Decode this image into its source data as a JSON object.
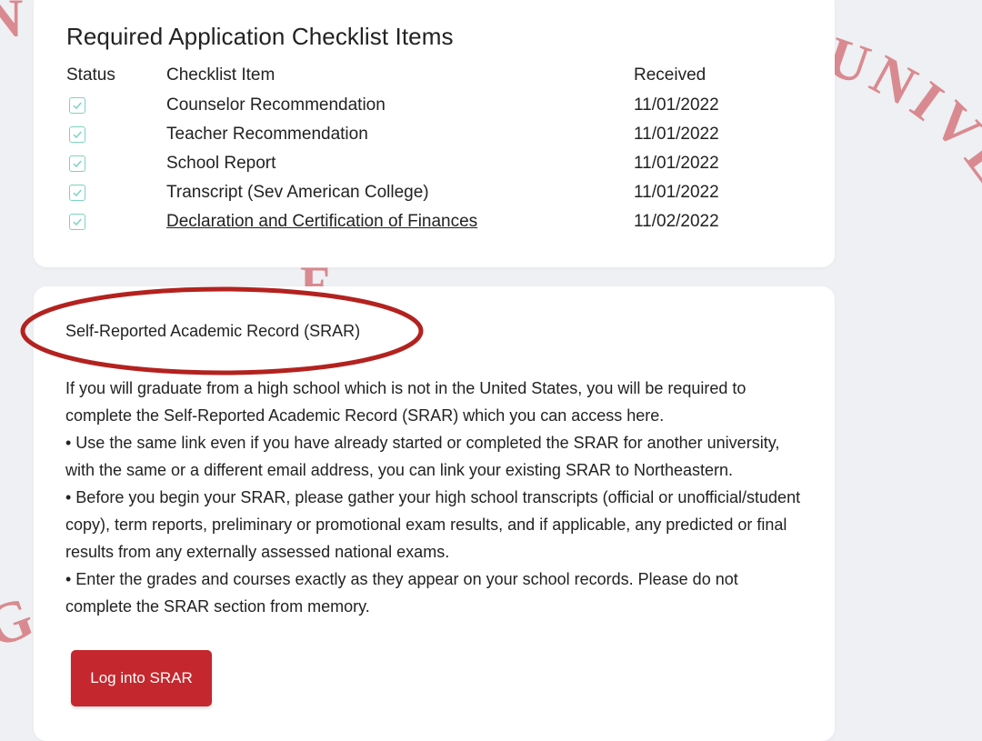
{
  "watermark": {
    "arc_right_text": "UNIVERSITY",
    "left_top_glyph": "N",
    "left_bottom_glyph": "G",
    "middle_glyph": "F",
    "color": "#d98a90"
  },
  "checklist": {
    "title": "Required Application Checklist Items",
    "headers": {
      "status": "Status",
      "item": "Checklist Item",
      "received": "Received"
    },
    "rows": [
      {
        "item": "Counselor Recommendation",
        "received": "11/01/2022",
        "is_link": false
      },
      {
        "item": "Teacher Recommendation",
        "received": "11/01/2022",
        "is_link": false
      },
      {
        "item": "School Report",
        "received": "11/01/2022",
        "is_link": false
      },
      {
        "item": "Transcript (Sev American College)",
        "received": "11/01/2022",
        "is_link": false
      },
      {
        "item": "Declaration and Certification of Finances",
        "received": "11/02/2022",
        "is_link": true
      }
    ],
    "check_color": "#7fd2bf"
  },
  "srar": {
    "heading": "Self-Reported Academic Record (SRAR)",
    "highlight_color": "#b3221f",
    "paragraphs": [
      "If you will graduate from a high school which is not in the United States, you will be required to complete the Self-Reported Academic Record (SRAR) which you can access here.",
      "• Use the same link even if you have already started or completed the SRAR for another university, with the same or a different email address, you can link your existing SRAR to Northeastern.",
      "• Before you begin your SRAR, please gather your high school transcripts (official or unofficial/student copy), term reports, preliminary or promotional exam results, and if applicable, any predicted or final results from any externally assessed national exams.",
      "• Enter the grades and courses exactly as they appear on your school records. Please do not complete the SRAR section from memory."
    ],
    "button_label": "Log into SRAR",
    "button_color": "#c4272d"
  }
}
